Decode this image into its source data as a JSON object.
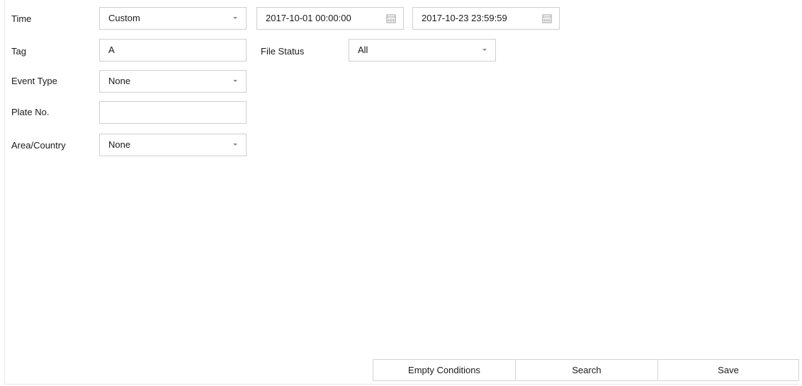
{
  "form": {
    "time": {
      "label": "Time",
      "mode": "Custom",
      "start": "2017-10-01 00:00:00",
      "end": "2017-10-23 23:59:59"
    },
    "tag": {
      "label": "Tag",
      "value": "A"
    },
    "file_status": {
      "label": "File Status",
      "value": "All"
    },
    "event_type": {
      "label": "Event Type",
      "value": "None"
    },
    "plate_no": {
      "label": "Plate No.",
      "value": ""
    },
    "area_country": {
      "label": "Area/Country",
      "value": "None"
    }
  },
  "buttons": {
    "empty_conditions": "Empty Conditions",
    "search": "Search",
    "save": "Save"
  },
  "icons": {
    "dropdown": "chevron-down-icon",
    "calendar": "calendar-icon"
  }
}
